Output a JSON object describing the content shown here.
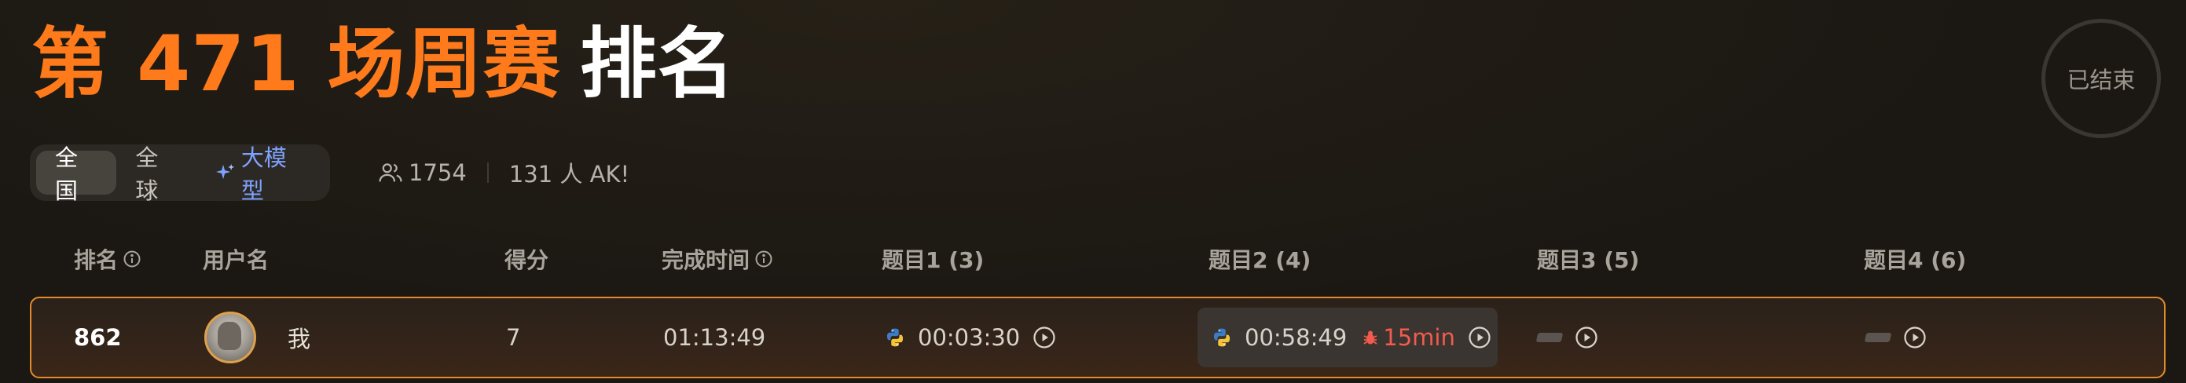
{
  "title": {
    "highlight": "第 471 场周赛",
    "rest": "排名"
  },
  "status_label": "已结束",
  "tabs": [
    {
      "label": "全国",
      "active": true
    },
    {
      "label": "全球",
      "active": false
    },
    {
      "label": "大模型",
      "active": false,
      "icon": "sparkle-icon"
    }
  ],
  "stats": {
    "participants": "1754",
    "ak": "131 人 AK!"
  },
  "table": {
    "headers": {
      "rank": "排名",
      "username": "用户名",
      "score": "得分",
      "finish_time": "完成时间",
      "q1": "题目1 (3)",
      "q2": "题目2 (4)",
      "q3": "题目3 (5)",
      "q4": "题目4 (6)"
    },
    "row": {
      "rank": "862",
      "username": "我",
      "score": "7",
      "finish_time": "01:13:49",
      "q1": {
        "time": "00:03:30",
        "language_icon": "python-icon"
      },
      "q2": {
        "time": "00:58:49",
        "penalty": "15min",
        "language_icon": "python-icon"
      },
      "q3": {
        "time": ""
      },
      "q4": {
        "time": ""
      }
    }
  },
  "colors": {
    "accent_orange": "#ff7a1a",
    "penalty_red": "#f25b4e",
    "ai_blue": "#7fa2ff",
    "row_border": "#e58a2b"
  }
}
